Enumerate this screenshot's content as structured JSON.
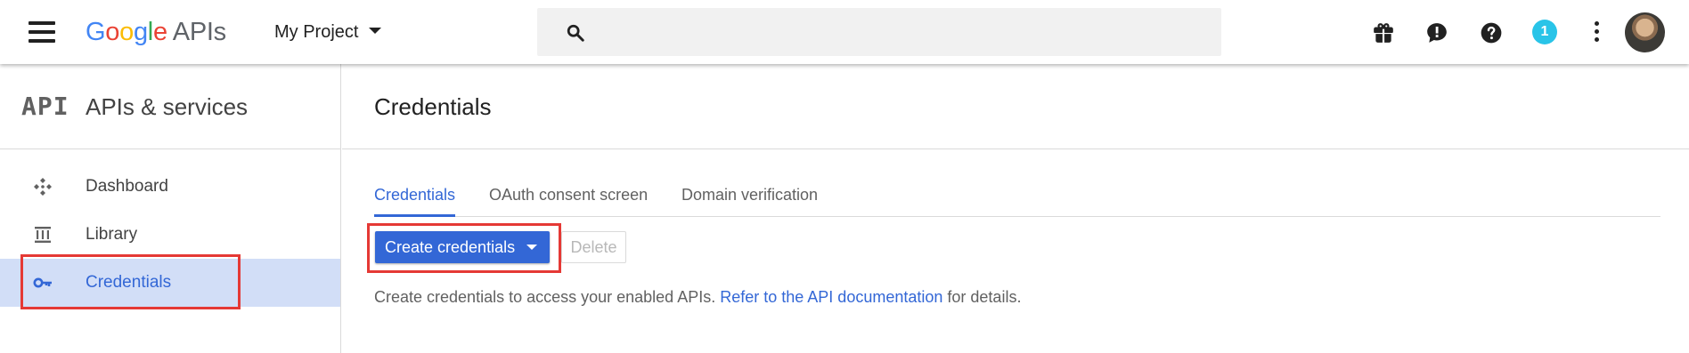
{
  "colors": {
    "accent": "#3367d6",
    "active_bg": "#d2def7",
    "highlight_border": "#e53935",
    "badge_bg": "#29c4e8",
    "google_blue": "#4285f4",
    "google_red": "#ea4335",
    "google_yellow": "#fbbc05",
    "google_green": "#34a853"
  },
  "topbar": {
    "menu_icon": "hamburger-menu-icon",
    "logo_letters": [
      "G",
      "o",
      "o",
      "g",
      "l",
      "e"
    ],
    "logo_suffix": "APIs",
    "project_name": "My Project",
    "search_icon": "search-icon",
    "search_placeholder": "",
    "icons": [
      "gift-icon",
      "feedback-icon",
      "help-icon",
      "notifications-badge",
      "more-vert-icon",
      "avatar"
    ],
    "notification_count": "1"
  },
  "sidebar": {
    "logo_text": "API",
    "title": "APIs & services",
    "items": [
      {
        "label": "Dashboard",
        "icon": "dashboard-icon",
        "active": false
      },
      {
        "label": "Library",
        "icon": "library-icon",
        "active": false
      },
      {
        "label": "Credentials",
        "icon": "key-icon",
        "active": true
      }
    ]
  },
  "main": {
    "title": "Credentials",
    "tabs": [
      {
        "label": "Credentials",
        "active": true
      },
      {
        "label": "OAuth consent screen",
        "active": false
      },
      {
        "label": "Domain verification",
        "active": false
      }
    ],
    "create_button_label": "Create credentials",
    "delete_button_label": "Delete",
    "description_text": "Create credentials to access your enabled APIs.",
    "description_link": "Refer to the API documentation",
    "description_suffix": "for details."
  }
}
